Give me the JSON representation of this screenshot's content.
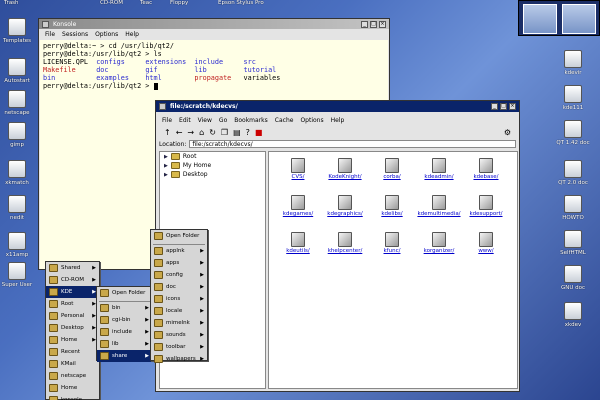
{
  "desktop": {
    "top_labels": [
      "Trash",
      "CD-ROM",
      "Teac",
      "Floppy",
      "Epson Stylus Pro"
    ],
    "left_icons": [
      "Templates",
      "Autostart",
      "netscape",
      "gimp",
      "xkmatch",
      "nedit",
      "x11amp",
      "Super User"
    ],
    "right_icons": [
      "kdevir",
      "kde111",
      "QT 1.42 doc",
      "QT 2.0 doc",
      "HOWTO",
      "SelfHTML",
      "GNU doc",
      "xkdev"
    ]
  },
  "terminal": {
    "title": "Konsole",
    "menu": [
      "File",
      "Sessions",
      "Options",
      "Help"
    ],
    "lines": [
      [
        {
          "t": "perry@delta:~ > cd /usr/lib/qt2/",
          "c": "#000000"
        }
      ],
      [
        {
          "t": "perry@delta:/usr/lib/qt2 > ls",
          "c": "#000000"
        }
      ],
      [
        {
          "t": "LICENSE.QPL  ",
          "c": "#000000"
        },
        {
          "t": "configs     ",
          "c": "#2a2ad0"
        },
        {
          "t": "extensions  ",
          "c": "#2a2ad0"
        },
        {
          "t": "include     ",
          "c": "#2a2ad0"
        },
        {
          "t": "src",
          "c": "#2a2ad0"
        }
      ],
      [
        {
          "t": "Makefile     ",
          "c": "#c02020"
        },
        {
          "t": "doc         ",
          "c": "#2a2ad0"
        },
        {
          "t": "gif         ",
          "c": "#2a2ad0"
        },
        {
          "t": "lib         ",
          "c": "#2a2ad0"
        },
        {
          "t": "tutorial",
          "c": "#2a2ad0"
        }
      ],
      [
        {
          "t": "bin          ",
          "c": "#2a2ad0"
        },
        {
          "t": "examples    ",
          "c": "#2a2ad0"
        },
        {
          "t": "html        ",
          "c": "#2a2ad0"
        },
        {
          "t": "propagate   ",
          "c": "#c02020"
        },
        {
          "t": "variables",
          "c": "#000000"
        }
      ],
      [
        {
          "t": "perry@delta:/usr/lib/qt2 > ",
          "c": "#000000"
        }
      ]
    ]
  },
  "filemanager": {
    "title": "file:/scratch/kdecvs/",
    "menu": [
      "File",
      "Edit",
      "View",
      "Go",
      "Bookmarks",
      "Cache",
      "Options",
      "Help"
    ],
    "location_label": "Location:",
    "location_value": "file:/scratch/kdecvs/",
    "tree": [
      "Root",
      "My Home",
      "Desktop"
    ],
    "files": [
      "CVS/",
      "KodeKnight/",
      "corba/",
      "kdeadmin/",
      "kdebase/",
      "kdegames/",
      "kdegraphics/",
      "kdelibs/",
      "kdemultimedia/",
      "kdesupport/",
      "kdeutils/",
      "khelpcenter/",
      "kfunc/",
      "korganizer/",
      "www/"
    ]
  },
  "menus": {
    "main": [
      "Shared",
      "CD-ROM",
      "KDE",
      "Root",
      "Personal",
      "Desktop",
      "Home",
      "Recent",
      "KMail",
      "netscape",
      "Home",
      "konsole"
    ],
    "kde": [
      "Open Folder",
      "bin",
      "cgi-bin",
      "include",
      "lib",
      "share"
    ],
    "share": [
      "Open Folder",
      "applnk",
      "apps",
      "config",
      "doc",
      "icons",
      "locale",
      "mimelnk",
      "sounds",
      "toolbar",
      "wallpapers"
    ]
  }
}
